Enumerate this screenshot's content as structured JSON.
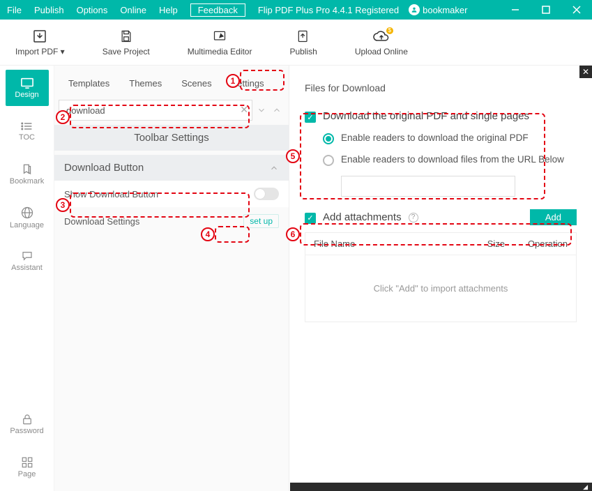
{
  "titlebar": {
    "menu": [
      "File",
      "Publish",
      "Options",
      "Online",
      "Help"
    ],
    "feedback": "Feedback",
    "app_title": "Flip PDF Plus Pro 4.4.1 Registered",
    "username": "bookmaker"
  },
  "toolbar": {
    "import": "Import PDF ▾",
    "save": "Save Project",
    "multimedia": "Multimedia Editor",
    "publish": "Publish",
    "upload": "Upload Online"
  },
  "leftnav": {
    "items": [
      {
        "label": "Design"
      },
      {
        "label": "TOC"
      },
      {
        "label": "Bookmark"
      },
      {
        "label": "Language"
      },
      {
        "label": "Assistant"
      },
      {
        "label": "Password"
      },
      {
        "label": "Page"
      }
    ]
  },
  "tabs": [
    "Templates",
    "Themes",
    "Scenes",
    "Settings"
  ],
  "search": {
    "value": "download"
  },
  "sections": {
    "toolbar_settings": "Toolbar Settings",
    "download_button": "Download Button",
    "show_download": "Show Download Button",
    "download_settings_label": "Download Settings",
    "setup": "set up"
  },
  "right": {
    "title": "Files for Download",
    "chk_orig": "Download the original PDF and single pages",
    "radio_orig": "Enable readers to download the original PDF",
    "radio_url": "Enable readers to download files from the URL Below",
    "attach_label": "Add attachments",
    "add_btn": "Add",
    "col_file": "File Name",
    "col_size": "Size",
    "col_op": "Operation",
    "empty": "Click \"Add\" to import attachments"
  },
  "annotations": [
    "1",
    "2",
    "3",
    "4",
    "5",
    "6"
  ]
}
